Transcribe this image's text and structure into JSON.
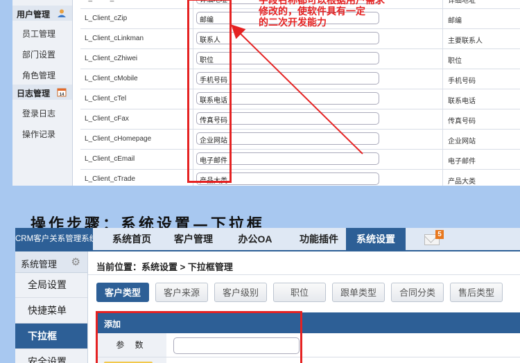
{
  "top_screenshot": {
    "sidebar": {
      "section1": {
        "label": "用户管理",
        "icon": "user-icon"
      },
      "items1": [
        "员工管理",
        "部门设置",
        "角色管理"
      ],
      "section2": {
        "label": "日志管理",
        "icon": "calendar-icon",
        "icon_text": "14"
      },
      "items2": [
        "登录日志",
        "操作记录"
      ]
    },
    "rows": [
      {
        "field": "L_Client_cAddress",
        "value": "详细地址",
        "label": "详细地址"
      },
      {
        "field": "L_Client_cZip",
        "value": "邮编",
        "label": "邮编"
      },
      {
        "field": "L_Client_cLinkman",
        "value": "联系人",
        "label": "主要联系人"
      },
      {
        "field": "L_Client_cZhiwei",
        "value": "职位",
        "label": "职位"
      },
      {
        "field": "L_Client_cMobile",
        "value": "手机号码",
        "label": "手机号码"
      },
      {
        "field": "L_Client_cTel",
        "value": "联系电话",
        "label": "联系电话"
      },
      {
        "field": "L_Client_cFax",
        "value": "传真号码",
        "label": "传真号码"
      },
      {
        "field": "L_Client_cHomepage",
        "value": "企业网站",
        "label": "企业网站"
      },
      {
        "field": "L_Client_cEmail",
        "value": "电子邮件",
        "label": "电子邮件"
      },
      {
        "field": "L_Client_cTrade",
        "value": "产品大类",
        "label": "产品大类"
      }
    ],
    "annotation": [
      "字段名称都可以根据用户需求",
      "修改的，使软件具有一定",
      "的二次开发能力"
    ],
    "accent_color": "#e52222"
  },
  "heading": "操作步骤：系统设置—下拉框",
  "bottom_screenshot": {
    "brand": "CRM客户关系管理系统",
    "nav": [
      "系统首页",
      "客户管理",
      "办公OA",
      "功能插件",
      "系统设置"
    ],
    "active_nav": "系统设置",
    "mail_icon": "mail-icon",
    "mail_count": "5",
    "sidebar": {
      "header": "系统管理",
      "header_icon": "gear-icon",
      "items": [
        "全局设置",
        "快捷菜单",
        "下拉框",
        "安全设置"
      ],
      "active": "下拉框"
    },
    "breadcrumb": "当前位置：系统设置 > 下拉框管理",
    "tabs": [
      "客户类型",
      "客户来源",
      "客户级别",
      "职位",
      "跟单类型",
      "合同分类",
      "售后类型"
    ],
    "active_tab": "客户类型",
    "form": {
      "title": "添加",
      "param_label": "参 数",
      "param_value": ""
    },
    "brand_color": "#2d5f96"
  }
}
